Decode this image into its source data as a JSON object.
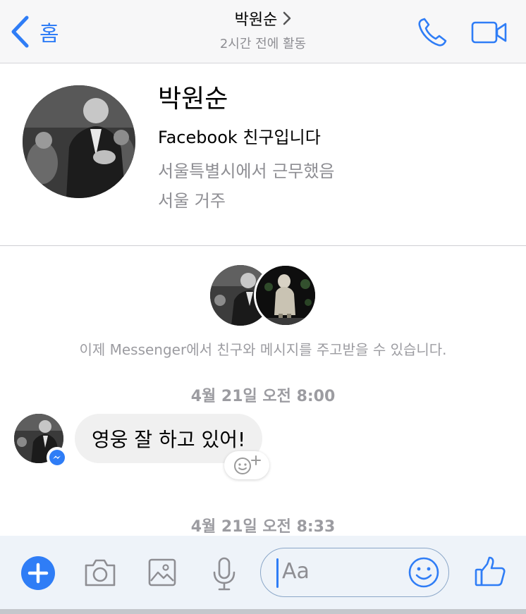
{
  "nav": {
    "back_label": "홈",
    "title": "박원순",
    "status": "2시간 전에 활동"
  },
  "profile": {
    "name": "박원순",
    "relation": "Facebook 친구입니다",
    "work": "서울특별시에서 근무했음",
    "lives": "서울 거주"
  },
  "connection": {
    "text": "이제 Messenger에서 친구와 메시지를 주고받을 수 있습니다."
  },
  "messages": [
    {
      "timestamp": "4월 21일 오전 8:00",
      "text": "영웅 잘 하고 있어!"
    },
    {
      "timestamp": "4월 21일 오전 8:33"
    }
  ],
  "composer": {
    "placeholder": "Aa"
  },
  "colors": {
    "accent": "#2f7df6",
    "secondary_text": "#8e8e93",
    "bubble": "#f0f0f0"
  },
  "icons": [
    "back-chevron-icon",
    "chevron-right-icon",
    "phone-icon",
    "video-camera-icon",
    "messenger-icon",
    "add-reaction-icon",
    "plus-icon",
    "camera-icon",
    "image-icon",
    "microphone-icon",
    "smiley-icon",
    "thumbs-up-icon"
  ]
}
